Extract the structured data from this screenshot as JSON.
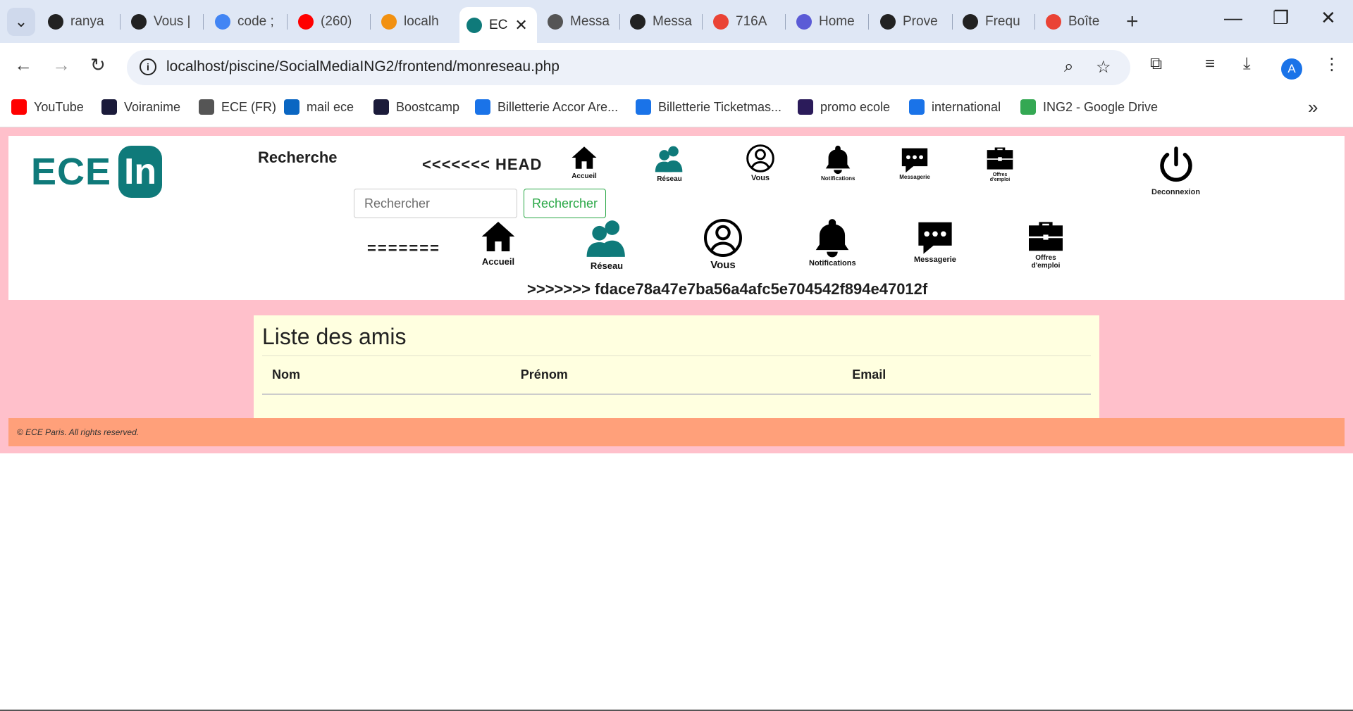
{
  "browser": {
    "tabs": [
      {
        "label": "ranya",
        "icon": "github-icon",
        "color": "#222222"
      },
      {
        "label": "Vous |",
        "icon": "smiley-icon",
        "color": "#222222"
      },
      {
        "label": "code ;",
        "icon": "google-icon",
        "color": "#4285f4"
      },
      {
        "label": "(260)",
        "icon": "youtube-icon",
        "color": "#ff0000"
      },
      {
        "label": "localh",
        "icon": "phpmyadmin-icon",
        "color": "#f29111"
      },
      {
        "label": "EC",
        "icon": "ecein-icon",
        "color": "#0f7a7a"
      },
      {
        "label": "Messa",
        "icon": "globe-icon",
        "color": "#555555"
      },
      {
        "label": "Messa",
        "icon": "openai-icon",
        "color": "#222222"
      },
      {
        "label": "716A",
        "icon": "gmail-icon",
        "color": "#ea4335"
      },
      {
        "label": "Home",
        "icon": "user-icon",
        "color": "#5b5bd6"
      },
      {
        "label": "Prove",
        "icon": "castle-icon",
        "color": "#222222"
      },
      {
        "label": "Frequ",
        "icon": "silhouette-icon",
        "color": "#222222"
      },
      {
        "label": "Boîte",
        "icon": "gmail-icon",
        "color": "#ea4335"
      }
    ],
    "url": "localhost/piscine/SocialMediaING2/frontend/monreseau.php",
    "avatar_letter": "A",
    "bookmarks": [
      {
        "label": "YouTube",
        "icon": "youtube-icon",
        "color": "#ff0000"
      },
      {
        "label": "Voiranime",
        "icon": "voiranime-icon",
        "color": "#1b1b3a"
      },
      {
        "label": "ECE (FR)",
        "icon": "globe-icon",
        "color": "#555555"
      },
      {
        "label": "mail ece",
        "icon": "outlook-icon",
        "color": "#0a66c2"
      },
      {
        "label": "Boostcamp",
        "icon": "boostcamp-icon",
        "color": "#1b1b3a"
      },
      {
        "label": "Billetterie Accor Are...",
        "icon": "ticket-icon",
        "color": "#1a73e8"
      },
      {
        "label": "Billetterie Ticketmas...",
        "icon": "ticket-icon",
        "color": "#1a73e8"
      },
      {
        "label": "promo ecole",
        "icon": "school-icon",
        "color": "#2b1b5a"
      },
      {
        "label": "international",
        "icon": "intl-icon",
        "color": "#1a73e8"
      },
      {
        "label": "ING2 - Google Drive",
        "icon": "drive-icon",
        "color": "#34a853"
      }
    ]
  },
  "header": {
    "logo_text": "ECE",
    "logo_badge": "In",
    "search_title": "Recherche",
    "conflict_head": "<<<<<<< HEAD",
    "conflict_sep": "=======",
    "conflict_end": ">>>>>>> fdace78a47e7ba56a4afc5e704542f894e47012f",
    "search_placeholder": "Rechercher",
    "search_button": "Rechercher",
    "nav_small": {
      "accueil": "Accueil",
      "reseau": "Réseau",
      "vous": "Vous",
      "notifications": "Notifications",
      "messagerie": "Messagerie",
      "offres": "Offres d'emploi"
    },
    "nav_large": {
      "accueil": "Accueil",
      "reseau": "Réseau",
      "vous": "Vous",
      "notifications": "Notifications",
      "messagerie": "Messagerie",
      "offres": "Offres d'emploi"
    },
    "logout": "Deconnexion"
  },
  "friends": {
    "title": "Liste des amis",
    "columns": [
      "Nom",
      "Prénom",
      "Email"
    ]
  },
  "footer": {
    "text": "© ECE Paris. All rights reserved."
  },
  "colors": {
    "page_bg": "#ffc0cb",
    "brand": "#0f7a7a",
    "panel": "#ffffe0",
    "footer": "#ffa07a",
    "success": "#28a745"
  }
}
